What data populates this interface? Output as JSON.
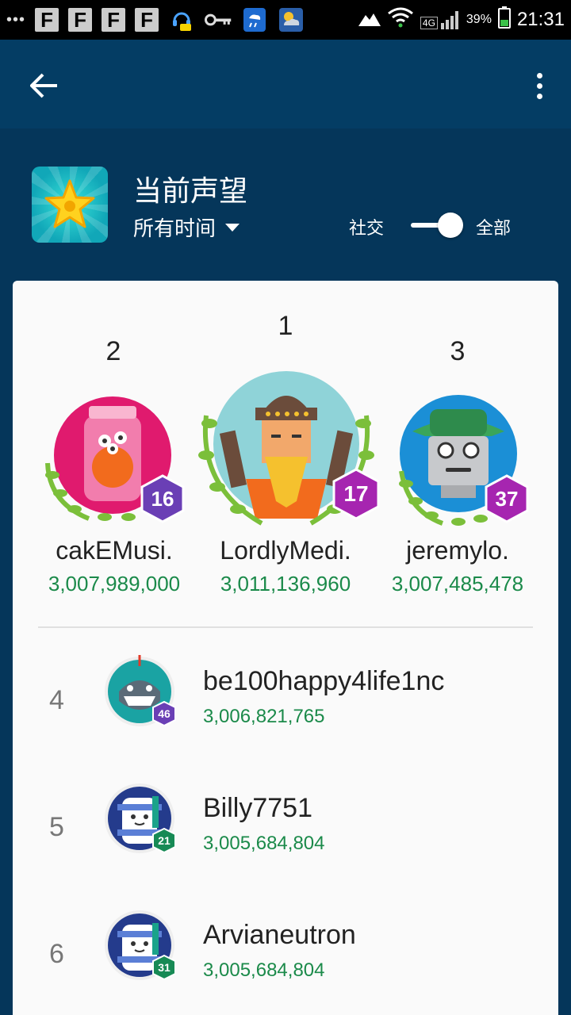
{
  "status_bar": {
    "dots": "•••",
    "notification_icons": [
      "F",
      "F",
      "F",
      "F"
    ],
    "network": "4G",
    "battery": "39%",
    "time": "21:31"
  },
  "header": {
    "title": "当前声望",
    "time_filter": "所有时间",
    "toggle_left": "社交",
    "toggle_right": "全部"
  },
  "podium": [
    {
      "rank": "2",
      "name": "cakEMusi.",
      "score": "3,007,989,000",
      "level": "16"
    },
    {
      "rank": "1",
      "name": "LordlyMedi.",
      "score": "3,011,136,960",
      "level": "17"
    },
    {
      "rank": "3",
      "name": "jeremylo.",
      "score": "3,007,485,478",
      "level": "37"
    }
  ],
  "list": [
    {
      "rank": "4",
      "name": "be100happy4life1nc",
      "score": "3,006,821,765",
      "level": "46"
    },
    {
      "rank": "5",
      "name": "Billy7751",
      "score": "3,005,684,804",
      "level": "21"
    },
    {
      "rank": "6",
      "name": "Arvianeutron",
      "score": "3,005,684,804",
      "level": "31"
    }
  ],
  "colors": {
    "app_bar": "#043d64",
    "background": "#05365a",
    "score_green": "#1b8a4a",
    "badge_purple": "#6a3fb5",
    "badge_magenta": "#a625b0",
    "badge_green": "#178a55"
  }
}
